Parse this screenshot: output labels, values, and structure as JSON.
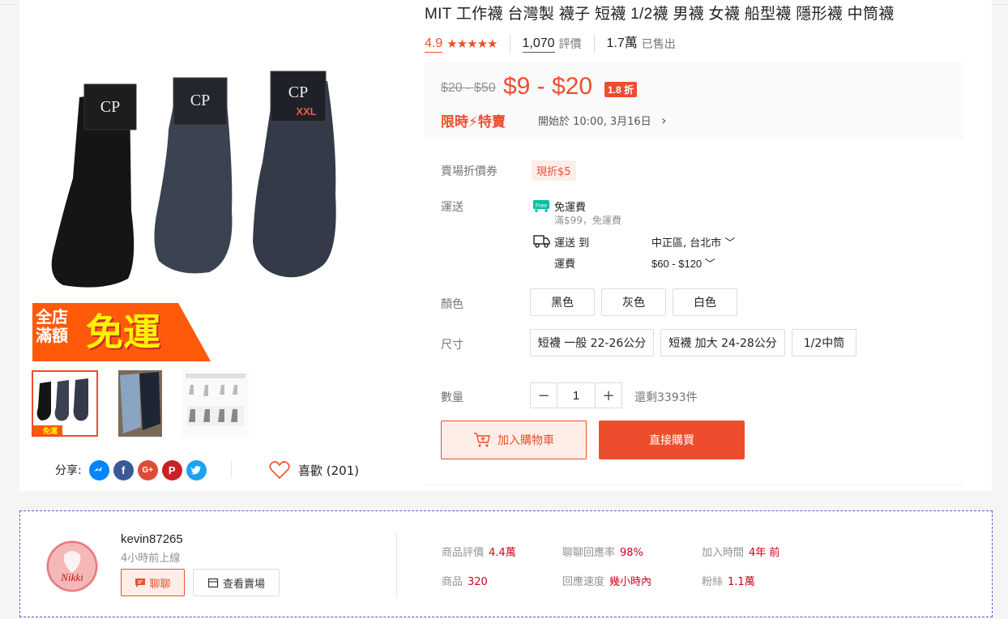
{
  "product": {
    "title": "MIT 工作襪 台灣製 襪子 短襪 1/2襪 男襪 女襪 船型襪 隱形襪 中筒襪",
    "rating": "4.9",
    "stars": "★★★★★",
    "reviews_count": "1,070",
    "reviews_label": "評價",
    "sold_count": "1.7萬",
    "sold_label": "已售出"
  },
  "price": {
    "original": "$20 - $50",
    "current": "$9 - $20",
    "discount": "1.8 折",
    "flash_sale": "限時⚡特賣",
    "flash_start": "開始於 10:00, 3月16日",
    "flash_arrow": "›"
  },
  "voucher": {
    "label": "賣場折價券",
    "tag": "現折$5"
  },
  "shipping": {
    "label": "運送",
    "free_icon_text": "Free",
    "free": "免運費",
    "min": "滿$99，免運費",
    "to_label": "運送 到",
    "location": "中正區, 台北市",
    "fee_label": "運費",
    "fee": "$60 - $120"
  },
  "color": {
    "label": "顏色",
    "options": [
      "黑色",
      "灰色",
      "白色"
    ]
  },
  "size": {
    "label": "尺寸",
    "options": [
      "短襪 一般 22-26公分",
      "短襪 加大 24-28公分",
      "1/2中筒"
    ]
  },
  "quantity": {
    "label": "數量",
    "value": "1",
    "minus": "−",
    "plus": "+",
    "stock": "還剩3393件"
  },
  "buttons": {
    "add_to_cart": "加入購物車",
    "buy_now": "直接購買"
  },
  "gallery": {
    "promo_line1": "全店",
    "promo_line2": "滿額",
    "promo_big": "免運",
    "thumb_promo": "免運"
  },
  "share": {
    "label": "分享:",
    "icons": [
      "messenger-icon",
      "facebook-icon",
      "google-plus-icon",
      "pinterest-icon",
      "twitter-icon"
    ],
    "fb": "f",
    "gp": "G+",
    "pin": "P"
  },
  "like": {
    "label": "喜歡 (201)"
  },
  "seller": {
    "name": "kevin87265",
    "status": "4小時前上線",
    "chat": "聊聊",
    "view_shop": "查看賣場",
    "avatar_text": "Nikki",
    "stats": [
      {
        "label": "商品評價",
        "value": "4.4萬"
      },
      {
        "label": "聊聊回應率",
        "value": "98%"
      },
      {
        "label": "加入時間",
        "value": "4年 前"
      },
      {
        "label": "商品",
        "value": "320"
      },
      {
        "label": "回應速度",
        "value": "幾小時內"
      },
      {
        "label": "粉絲",
        "value": "1.1萬"
      }
    ]
  },
  "colors": {
    "accent": "#ee4d2d",
    "seller_value": "#d0011b",
    "free_badge": "#00bfa5"
  }
}
